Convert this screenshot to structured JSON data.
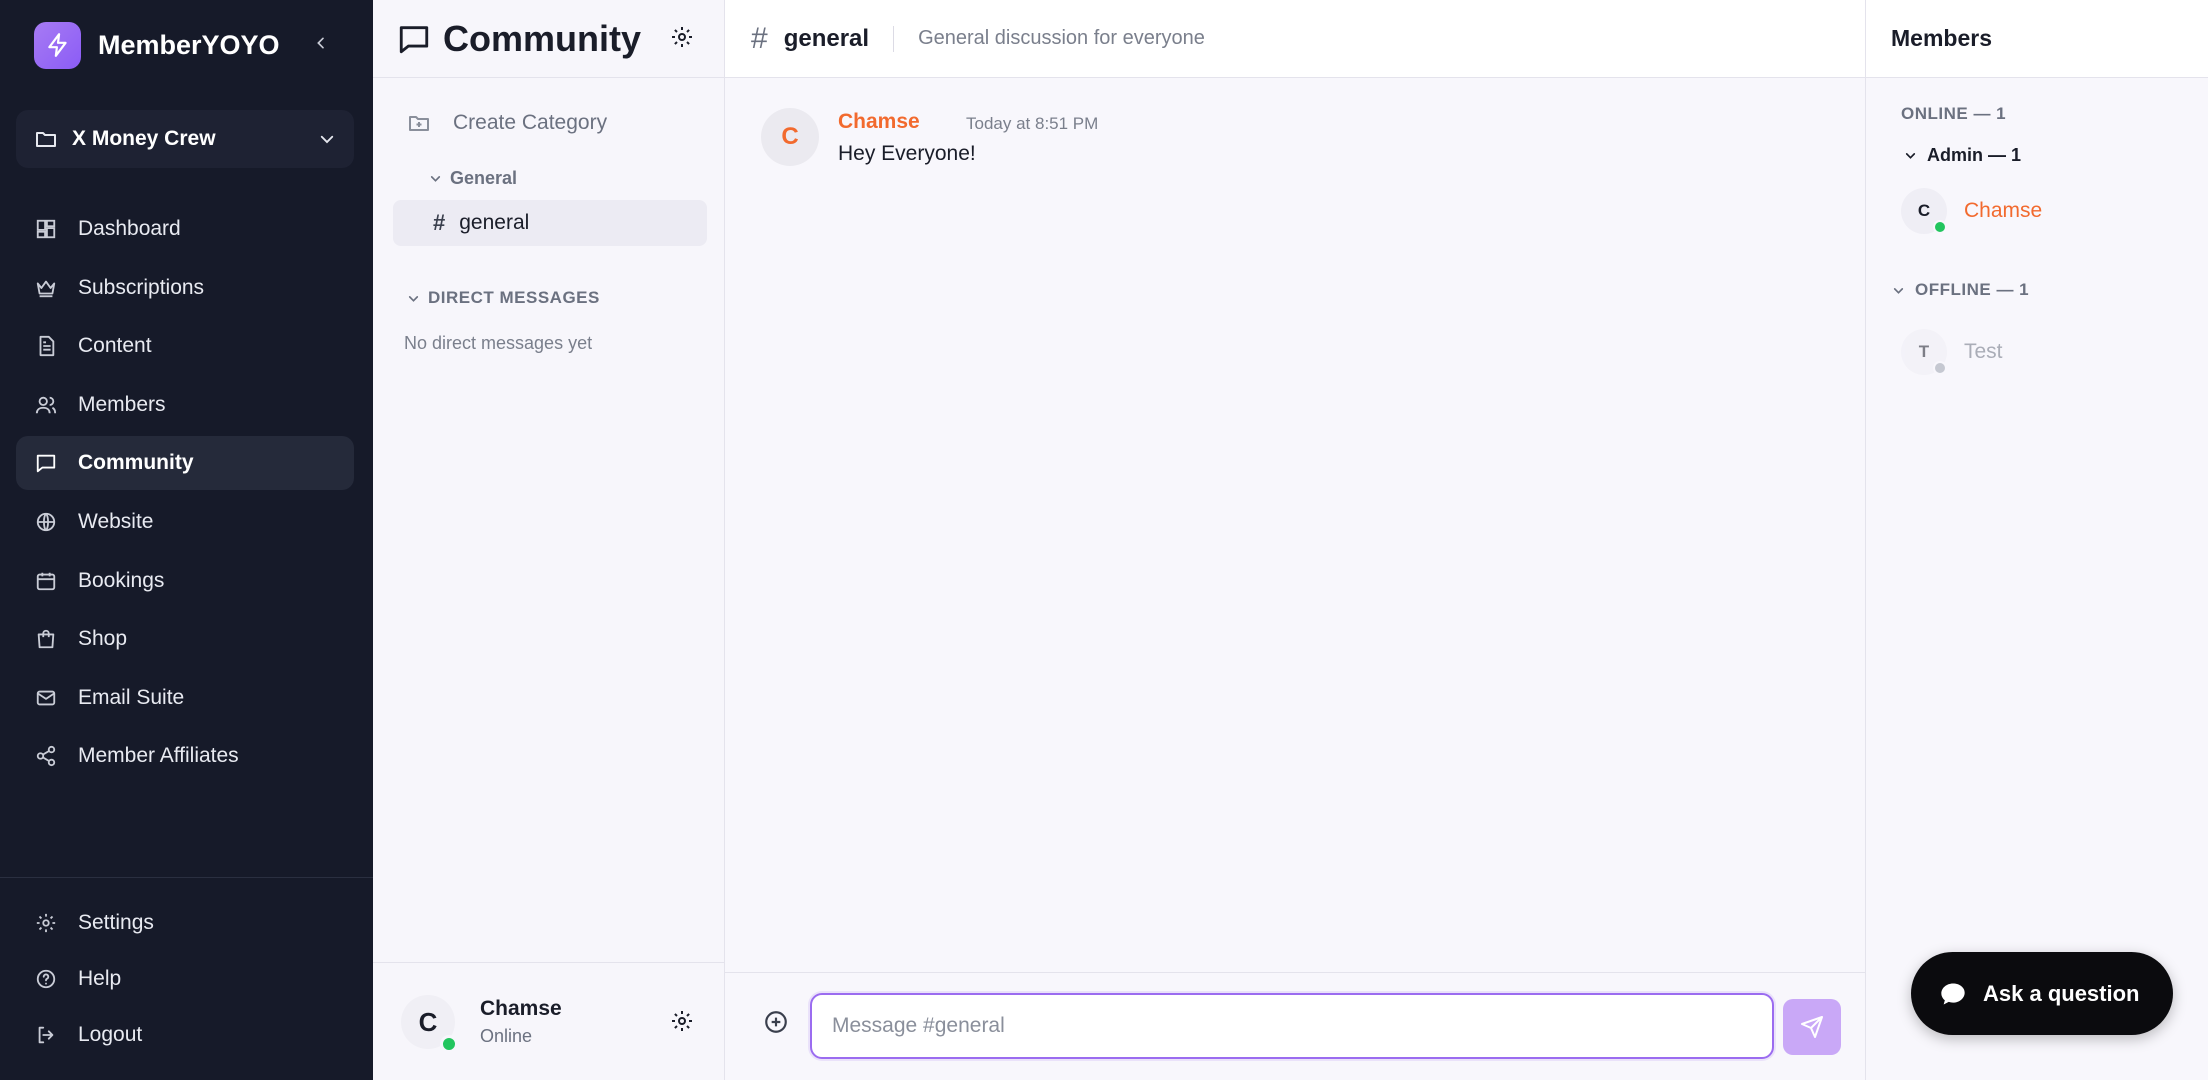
{
  "sidebar": {
    "app_name": "MemberYOYO",
    "workspace": "X Money Crew",
    "nav": [
      {
        "label": "Dashboard",
        "icon": "dashboard-icon"
      },
      {
        "label": "Subscriptions",
        "icon": "crown-icon"
      },
      {
        "label": "Content",
        "icon": "document-icon"
      },
      {
        "label": "Members",
        "icon": "users-icon"
      },
      {
        "label": "Community",
        "icon": "chat-bubble-icon",
        "active": true
      },
      {
        "label": "Website",
        "icon": "globe-icon"
      },
      {
        "label": "Bookings",
        "icon": "calendar-icon"
      },
      {
        "label": "Shop",
        "icon": "shopping-bag-icon"
      },
      {
        "label": "Email Suite",
        "icon": "mail-icon"
      },
      {
        "label": "Member Affiliates",
        "icon": "share-icon"
      }
    ],
    "bottom_nav": [
      {
        "label": "Settings",
        "icon": "gear-icon"
      },
      {
        "label": "Help",
        "icon": "help-icon"
      },
      {
        "label": "Logout",
        "icon": "logout-icon"
      }
    ]
  },
  "channels": {
    "title": "Community",
    "create_category": "Create Category",
    "category": "General",
    "channel": "general",
    "dm_header": "DIRECT MESSAGES",
    "dm_empty": "No direct messages yet",
    "user": {
      "initial": "C",
      "name": "Chamse",
      "status": "Online"
    }
  },
  "chat": {
    "hash": "#",
    "channel": "general",
    "topic": "General discussion for everyone",
    "messages": [
      {
        "initial": "C",
        "author": "Chamse",
        "time": "Today at 8:51 PM",
        "text": "Hey Everyone!"
      }
    ],
    "input_placeholder": "Message #general",
    "input_value": ""
  },
  "members": {
    "title": "Members",
    "online_label": "ONLINE — 1",
    "role_label": "Admin — 1",
    "online": [
      {
        "initial": "C",
        "name": "Chamse"
      }
    ],
    "offline_label": "OFFLINE — 1",
    "offline": [
      {
        "initial": "T",
        "name": "Test"
      }
    ]
  },
  "support": {
    "label": "Ask a question"
  },
  "colors": {
    "accent": "#8b5cf6",
    "author": "#f26a2e",
    "online": "#22c55e",
    "sidebar_bg": "#161a29"
  }
}
